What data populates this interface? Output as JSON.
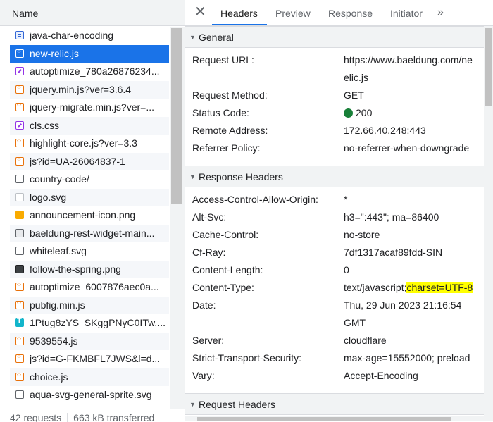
{
  "left_header": {
    "name_col": "Name"
  },
  "requests": [
    {
      "label": "java-char-encoding",
      "icon": "document-icon",
      "type": "doc"
    },
    {
      "label": "new-relic.js",
      "icon": "script-icon",
      "type": "js",
      "selected": true
    },
    {
      "label": "autoptimize_780a26876234...",
      "icon": "stylesheet-icon",
      "type": "css"
    },
    {
      "label": "jquery.min.js?ver=3.6.4",
      "icon": "script-icon",
      "type": "js"
    },
    {
      "label": "jquery-migrate.min.js?ver=...",
      "icon": "script-icon",
      "type": "js"
    },
    {
      "label": "cls.css",
      "icon": "stylesheet-icon",
      "type": "css"
    },
    {
      "label": "highlight-core.js?ver=3.3",
      "icon": "script-icon",
      "type": "js"
    },
    {
      "label": "js?id=UA-26064837-1",
      "icon": "script-icon",
      "type": "js"
    },
    {
      "label": "country-code/",
      "icon": "other-icon",
      "type": "other"
    },
    {
      "label": "logo.svg",
      "icon": "svg-image-icon",
      "type": "svg"
    },
    {
      "label": "announcement-icon.png",
      "icon": "image-icon",
      "type": "img-gold"
    },
    {
      "label": "baeldung-rest-widget-main...",
      "icon": "image-icon",
      "type": "img-gray"
    },
    {
      "label": "whiteleaf.svg",
      "icon": "svg-image-icon",
      "type": "png"
    },
    {
      "label": "follow-the-spring.png",
      "icon": "image-icon",
      "type": "img-dark"
    },
    {
      "label": "autoptimize_6007876aec0a...",
      "icon": "script-icon",
      "type": "js"
    },
    {
      "label": "pubfig.min.js",
      "icon": "script-icon",
      "type": "js"
    },
    {
      "label": "1Ptug8zYS_SKggPNyC0ITw....",
      "icon": "font-icon",
      "type": "font"
    },
    {
      "label": "9539554.js",
      "icon": "script-icon",
      "type": "js"
    },
    {
      "label": "js?id=G-FKMBFL7JWS&l=d...",
      "icon": "script-icon",
      "type": "js"
    },
    {
      "label": "choice.js",
      "icon": "script-icon",
      "type": "js"
    },
    {
      "label": "aqua-svg-general-sprite.svg",
      "icon": "other-icon",
      "type": "other"
    }
  ],
  "status_bar": {
    "requests": "42 requests",
    "transferred": "663 kB transferred"
  },
  "tabs": {
    "headers": "Headers",
    "preview": "Preview",
    "response": "Response",
    "initiator": "Initiator",
    "more": "»"
  },
  "general": {
    "title": "General",
    "request_url_key": "Request URL:",
    "request_url_line1": "https://www.baeldung.com/ne",
    "request_url_line2": "elic.js",
    "request_method_key": "Request Method:",
    "request_method": "GET",
    "status_code_key": "Status Code:",
    "status_code": "200",
    "status_color": "#188038",
    "remote_address_key": "Remote Address:",
    "remote_address": "172.66.40.248:443",
    "referrer_policy_key": "Referrer Policy:",
    "referrer_policy": "no-referrer-when-downgrade"
  },
  "response_headers": {
    "title": "Response Headers",
    "acao_key": "Access-Control-Allow-Origin:",
    "acao": "*",
    "alt_svc_key": "Alt-Svc:",
    "alt_svc": "h3=\":443\"; ma=86400",
    "cache_control_key": "Cache-Control:",
    "cache_control": "no-store",
    "cf_ray_key": "Cf-Ray:",
    "cf_ray": "7df1317acaf89fdd-SIN",
    "content_length_key": "Content-Length:",
    "content_length": "0",
    "content_type_key": "Content-Type:",
    "content_type_plain": "text/javascript;",
    "content_type_highlight": "charset=UTF-8",
    "highlight_color": "#ffff00",
    "date_key": "Date:",
    "date_line1": "Thu, 29 Jun 2023 21:16:54",
    "date_line2": "GMT",
    "server_key": "Server:",
    "server": "cloudflare",
    "hsts_key": "Strict-Transport-Security:",
    "hsts": "max-age=15552000; preload",
    "vary_key": "Vary:",
    "vary": "Accept-Encoding"
  },
  "request_headers": {
    "title": "Request Headers"
  }
}
